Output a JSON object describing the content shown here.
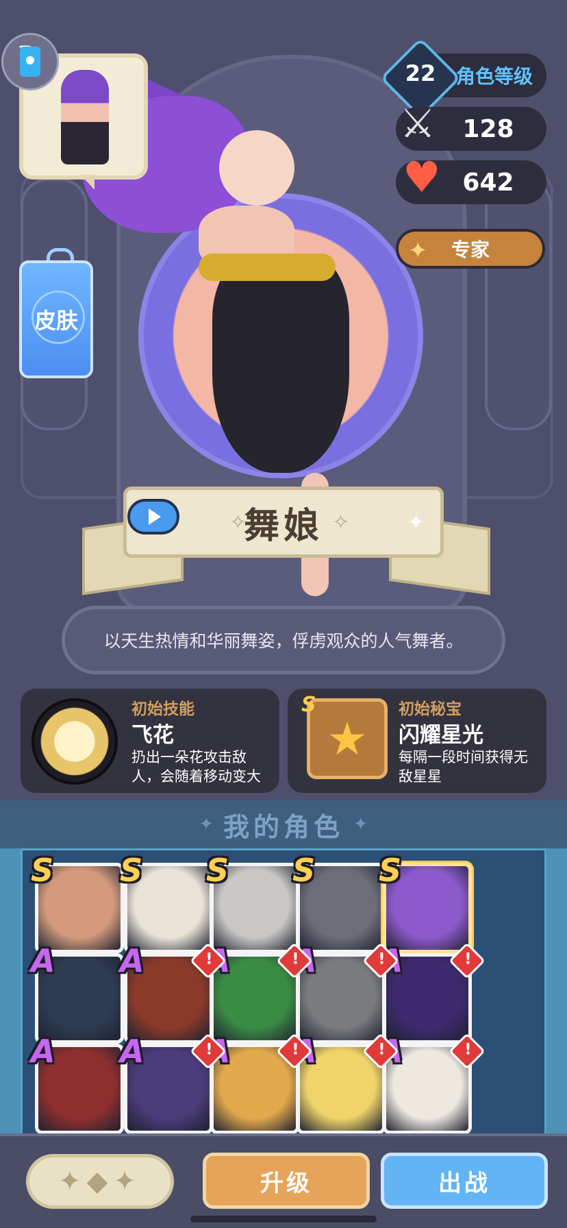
{
  "stats": {
    "level": "22",
    "level_label": "角色等级",
    "attack": "128",
    "health": "642",
    "class_label": "专家"
  },
  "skin_button_label": "皮肤",
  "character": {
    "name": "舞娘",
    "description": "以天生热情和华丽舞姿，俘虏观众的人气舞者。"
  },
  "initial_skill": {
    "label": "初始技能",
    "name": "飞花",
    "description": "扔出一朵花攻击敌人，会随着移动变大"
  },
  "initial_treasure": {
    "label": "初始秘宝",
    "rank": "S",
    "name": "闪耀星光",
    "description": "每隔一段时间获得无敌星星"
  },
  "roster": {
    "title": "我的角色",
    "rows": [
      [
        {
          "rank": "S",
          "alert": false,
          "color": "#d39a7c"
        },
        {
          "rank": "S",
          "alert": false,
          "color": "#e9e3d8"
        },
        {
          "rank": "S",
          "alert": false,
          "color": "#c9c7c4"
        },
        {
          "rank": "S",
          "alert": false,
          "color": "#6b6e78"
        },
        {
          "rank": "S",
          "alert": false,
          "color": "#8d5acc",
          "selected": true
        }
      ],
      [
        {
          "rank": "A",
          "alert": false,
          "color": "#2d3c52"
        },
        {
          "rank": "A",
          "alert": true,
          "color": "#8b3a2a"
        },
        {
          "rank": "A",
          "alert": true,
          "color": "#3b8c43"
        },
        {
          "rank": "A",
          "alert": true,
          "color": "#7a7b7f"
        },
        {
          "rank": "A",
          "alert": true,
          "color": "#3d2a6e"
        }
      ],
      [
        {
          "rank": "A",
          "alert": false,
          "color": "#8e2f2f"
        },
        {
          "rank": "A",
          "alert": true,
          "color": "#4b3c7a"
        },
        {
          "rank": "A",
          "alert": true,
          "color": "#e2a94c"
        },
        {
          "rank": "A",
          "alert": true,
          "color": "#f0d46a"
        },
        {
          "rank": "A",
          "alert": true,
          "color": "#ede8e0"
        }
      ]
    ]
  },
  "buttons": {
    "upgrade": "升级",
    "deploy": "出战"
  },
  "icons": {
    "attack": "sword-icon",
    "health": "heart-icon",
    "play": "play-icon",
    "device": "device-icon",
    "alert": "alert-icon"
  }
}
